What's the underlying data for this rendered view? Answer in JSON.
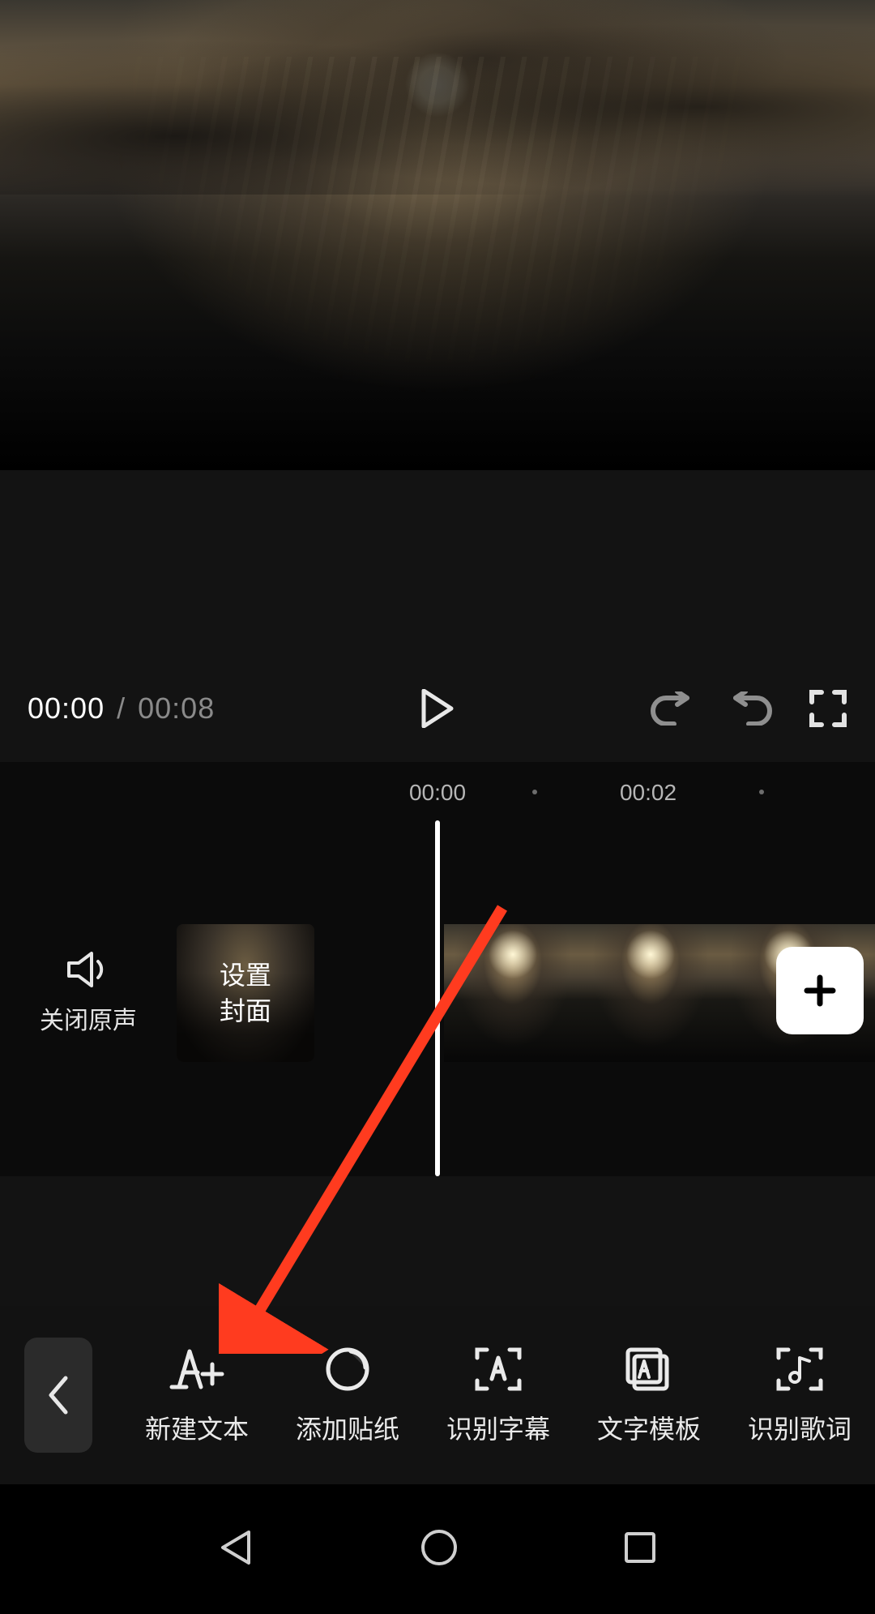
{
  "player": {
    "current_time": "00:00",
    "separator": "/",
    "duration": "00:08"
  },
  "timeline": {
    "ticks": [
      "00:00",
      "00:02"
    ],
    "audio_toggle_label": "关闭原声",
    "cover_button_line1": "设置",
    "cover_button_line2": "封面",
    "add_icon": "plus-icon"
  },
  "toolbar": {
    "back_icon": "chevron-left-icon",
    "items": [
      {
        "id": "new-text",
        "label": "新建文本",
        "icon": "text-add-icon"
      },
      {
        "id": "add-sticker",
        "label": "添加贴纸",
        "icon": "sticker-icon"
      },
      {
        "id": "auto-caption",
        "label": "识别字幕",
        "icon": "caption-scan-icon"
      },
      {
        "id": "text-template",
        "label": "文字模板",
        "icon": "text-template-icon"
      },
      {
        "id": "auto-lyrics",
        "label": "识别歌词",
        "icon": "lyrics-scan-icon"
      }
    ]
  },
  "icons": {
    "play": "play-icon",
    "undo": "undo-icon",
    "redo": "redo-icon",
    "fullscreen": "fullscreen-icon",
    "speaker": "speaker-icon"
  },
  "annotation": {
    "type": "arrow",
    "color": "#ff3b1f",
    "points_to": "new-text"
  },
  "nav": {
    "back": "triangle-back-icon",
    "home": "circle-home-icon",
    "recents": "square-recents-icon"
  }
}
